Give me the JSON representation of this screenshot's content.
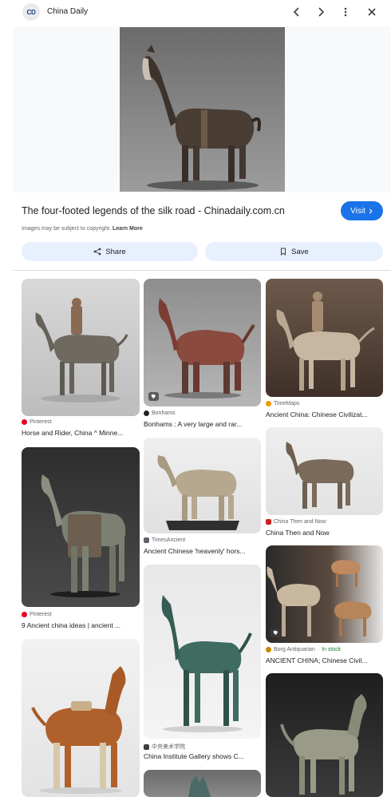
{
  "header": {
    "site_badge": "CD",
    "site_name": "China Daily",
    "icons": [
      "chevron-left-icon",
      "chevron-right-icon",
      "more-vert-icon",
      "close-icon"
    ]
  },
  "detail": {
    "title": "The four-footed legends of the silk road - Chinadaily.com.cn",
    "visit_label": "Visit",
    "copyright_text": "Images may be subject to copyright.",
    "learn_more_label": "Learn More",
    "share_label": "Share",
    "save_label": "Save"
  },
  "results": {
    "col1": [
      {
        "source": "Pinterest",
        "caption": "Horse and Rider, China ^ Minne..."
      },
      {
        "source": "Pinterest",
        "caption": "9 Ancient china ideas | ancient ..."
      },
      {
        "source": "",
        "caption": ""
      }
    ],
    "col2": [
      {
        "source": "Bonhams",
        "caption": "Bonhams : A very large and rar..."
      },
      {
        "source": "TimesAncient",
        "caption": "Ancient Chinese 'heavenly' hors..."
      },
      {
        "source": "中央美术学院",
        "caption": "China Institute Gallery shows C..."
      },
      {
        "source": "",
        "caption": ""
      }
    ],
    "col3": [
      {
        "source": "TimeMaps",
        "caption": "Ancient China: Chinese Civilizat..."
      },
      {
        "source": "China Then and Now",
        "caption": "China Then and Now"
      },
      {
        "source": "Borg Antiquarian",
        "stock": "In stock",
        "caption": "ANCIENT CHINA; Chinese Civil..."
      },
      {
        "source": "",
        "caption": ""
      }
    ]
  },
  "colors": {
    "accent": "#1a73e8",
    "pill_bg": "#e8f0fe",
    "pinterest": "#e60023",
    "in_stock": "#188038"
  }
}
